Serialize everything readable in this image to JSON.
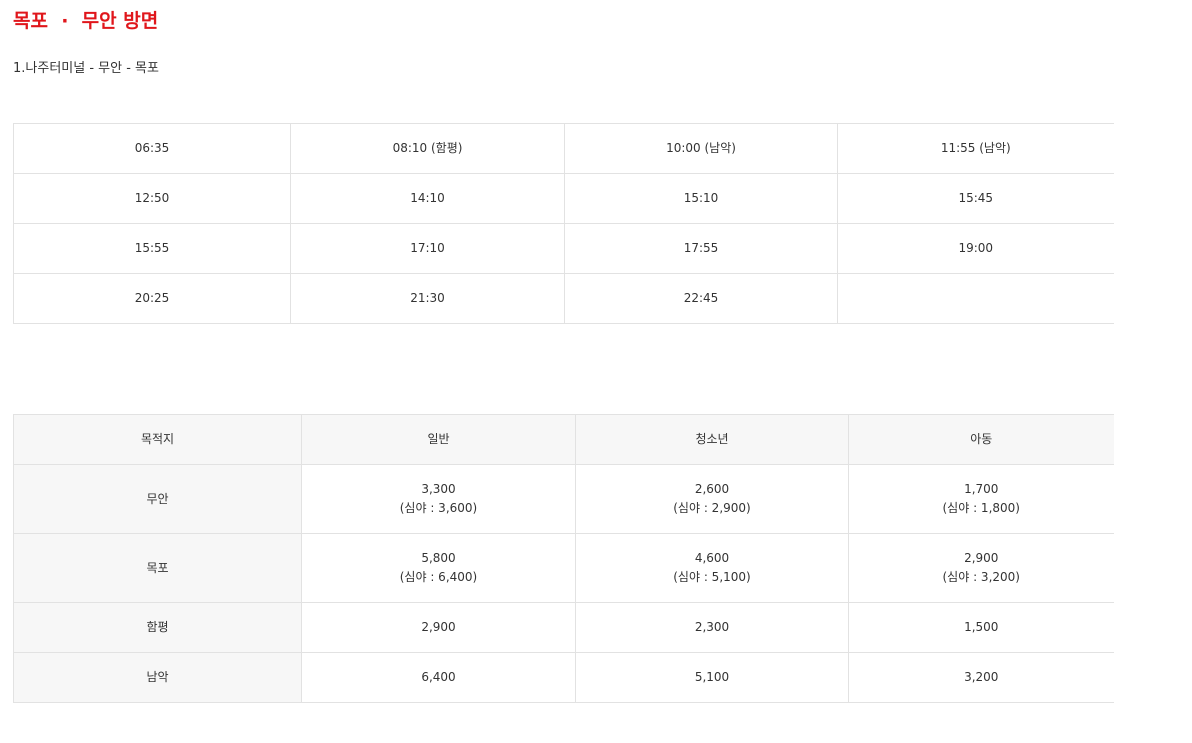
{
  "title": "목포  ·  무안 방면",
  "route": "1.나주터미널 - 무안 - 목포",
  "schedule": [
    [
      "06:35",
      "08:10 (함평)",
      "10:00 (남악)",
      "11:55 (남악)"
    ],
    [
      "12:50",
      "14:10",
      "15:10",
      "15:45"
    ],
    [
      "15:55",
      "17:10",
      "17:55",
      "19:00"
    ],
    [
      "20:25",
      "21:30",
      "22:45",
      ""
    ]
  ],
  "fares": {
    "headers": [
      "목적지",
      "일반",
      "청소년",
      "아동"
    ],
    "rows": [
      {
        "destination": "무안",
        "general": "3,300",
        "general_night": "(심야 : 3,600)",
        "youth": "2,600",
        "youth_night": "(심야 : 2,900)",
        "child": "1,700",
        "child_night": "(심야 : 1,800)"
      },
      {
        "destination": "목포",
        "general": "5,800",
        "general_night": "(심야 : 6,400)",
        "youth": "4,600",
        "youth_night": "(심야 : 5,100)",
        "child": "2,900",
        "child_night": "(심야 : 3,200)"
      },
      {
        "destination": "함평",
        "general": "2,900",
        "youth": "2,300",
        "child": "1,500"
      },
      {
        "destination": "남악",
        "general": "6,400",
        "youth": "5,100",
        "child": "3,200"
      }
    ]
  }
}
